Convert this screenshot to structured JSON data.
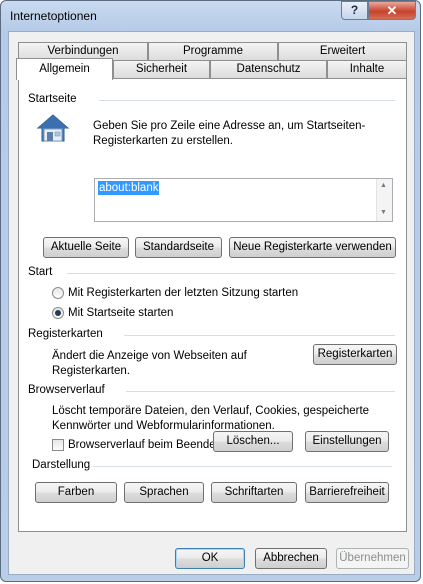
{
  "window": {
    "title": "Internetoptionen",
    "help_glyph": "?",
    "close_glyph": "✕"
  },
  "tabs": {
    "row_back": [
      "Verbindungen",
      "Programme",
      "Erweitert"
    ],
    "row_front": [
      "Allgemein",
      "Sicherheit",
      "Datenschutz",
      "Inhalte"
    ],
    "active": "Allgemein"
  },
  "startseite": {
    "heading": "Startseite",
    "description_line1": "Geben Sie pro Zeile eine Adresse an, um Startseiten-",
    "description_line2": "Registerkarten zu erstellen.",
    "url_value": "about:blank",
    "buttons": {
      "current": "Aktuelle Seite",
      "default": "Standardseite",
      "new_tab": "Neue Registerkarte verwenden"
    }
  },
  "start": {
    "heading": "Start",
    "option_last_session": "Mit Registerkarten der letzten Sitzung starten",
    "option_homepage": "Mit Startseite starten",
    "selected": "option_homepage"
  },
  "registerkarten": {
    "heading": "Registerkarten",
    "description_line1": "Ändert die Anzeige von Webseiten auf",
    "description_line2": "Registerkarten.",
    "button": "Registerkarten"
  },
  "browserverlauf": {
    "heading": "Browserverlauf",
    "description_line1": "Löscht temporäre Dateien, den Verlauf, Cookies, gespeicherte",
    "description_line2": "Kennwörter und Webformularinformationen.",
    "checkbox_label": "Browserverlauf beim Beenden löschen",
    "checkbox_checked": false,
    "delete_button": "Löschen...",
    "settings_button": "Einstellungen"
  },
  "darstellung": {
    "heading": "Darstellung",
    "buttons": {
      "colors": "Farben",
      "languages": "Sprachen",
      "fonts": "Schriftarten",
      "accessibility": "Barrierefreiheit"
    }
  },
  "footer": {
    "ok": "OK",
    "cancel": "Abbrechen",
    "apply": "Übernehmen"
  },
  "colors": {
    "highlight": "#f2b0b8",
    "selection": "#3399ff",
    "close_red": "#c7422c"
  }
}
